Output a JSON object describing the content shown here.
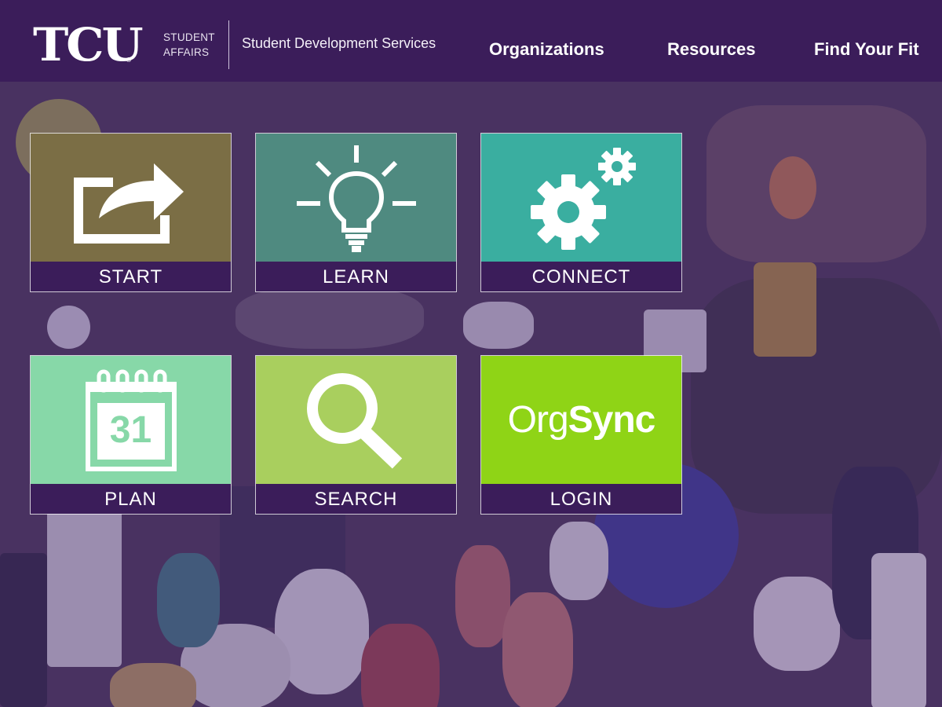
{
  "header": {
    "logo_text": "TCU",
    "logo_mark": "®",
    "affairs_line1": "STUDENT",
    "affairs_line2": "AFFAIRS",
    "department": "Student Development Services",
    "nav": [
      "Organizations",
      "Resources",
      "Find Your Fit"
    ],
    "background_color": "#3b1d5a"
  },
  "tiles": [
    {
      "label": "START",
      "icon": "share-arrow-icon",
      "color": "#7b6e45"
    },
    {
      "label": "LEARN",
      "icon": "lightbulb-icon",
      "color": "#4f8a80"
    },
    {
      "label": "CONNECT",
      "icon": "gears-icon",
      "color": "#3aaea0"
    },
    {
      "label": "PLAN",
      "icon": "calendar-icon",
      "color": "#87d8a8",
      "calendar_day": "31"
    },
    {
      "label": "SEARCH",
      "icon": "magnifier-icon",
      "color": "#a9cf5e"
    },
    {
      "label": "LOGIN",
      "icon": "orgsync-logo",
      "color": "#8fd416",
      "logo_regular": "Org",
      "logo_bold": "Sync"
    }
  ],
  "colors": {
    "label_bar": "#3b1d5a",
    "accent_purple": "#3b1d5a"
  }
}
